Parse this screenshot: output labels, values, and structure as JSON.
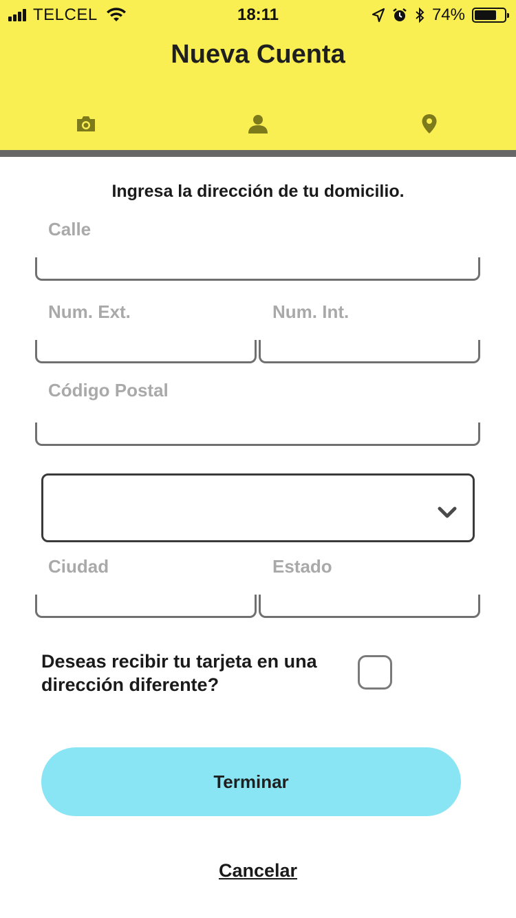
{
  "status_bar": {
    "carrier": "TELCEL",
    "time": "18:11",
    "battery": "74%",
    "battery_level": 0.74
  },
  "header": {
    "title": "Nueva Cuenta",
    "tabs": [
      {
        "icon": "camera-icon"
      },
      {
        "icon": "person-icon"
      },
      {
        "icon": "location-pin-icon"
      }
    ],
    "accent_color": "#f9ee52",
    "tab_icon_color": "#7d7a1c"
  },
  "form": {
    "instruction": "Ingresa la dirección de tu domicilio.",
    "fields": {
      "calle": {
        "label": "Calle",
        "value": ""
      },
      "num_ext": {
        "label": "Num. Ext.",
        "value": ""
      },
      "num_int": {
        "label": "Num. Int.",
        "value": ""
      },
      "codigo_postal": {
        "label": "Código Postal",
        "value": ""
      },
      "colonia": {
        "value": ""
      },
      "ciudad": {
        "label": "Ciudad",
        "value": ""
      },
      "estado": {
        "label": "Estado",
        "value": ""
      }
    },
    "different_address_question": "Deseas recibir tu tarjeta en una dirección diferente?",
    "different_address_checked": false
  },
  "actions": {
    "submit_label": "Terminar",
    "cancel_label": "Cancelar",
    "submit_color": "#89e5f4"
  }
}
